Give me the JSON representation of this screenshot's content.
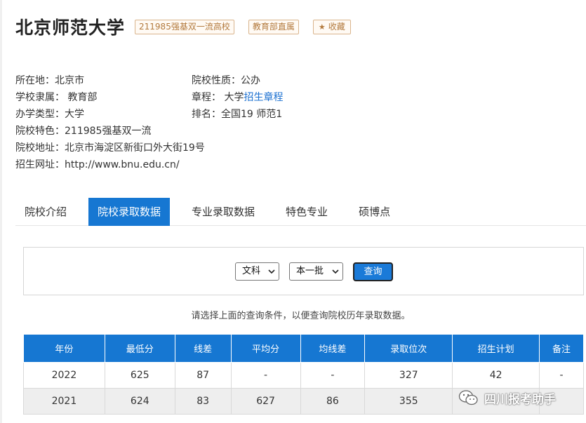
{
  "university": {
    "name": "北京师范大学",
    "tags": [
      "211985强基双一流高校",
      "教育部直属"
    ],
    "favorite_label": "收藏"
  },
  "info_left": [
    {
      "text": "所在地：北京市"
    },
    {
      "text": "学校隶属： 教育部"
    },
    {
      "text": "办学类型：大学"
    },
    {
      "text": "院校特色：211985强基双一流"
    },
    {
      "text": "院校地址：北京市海淀区新街口外大街19号"
    },
    {
      "text": "招生网址：http://www.bnu.edu.cn/"
    }
  ],
  "info_right": {
    "nature": "院校性质：公办",
    "charter_prefix": "章程： 大学",
    "charter_link": "招生章程",
    "ranking": "排名：全国19 师范1"
  },
  "tabs": [
    "院校介绍",
    "院校录取数据",
    "专业录取数据",
    "特色专业",
    "硕博点"
  ],
  "active_tab_index": 1,
  "query": {
    "subject_selected": "文科",
    "batch_selected": "本一批",
    "button_label": "查询"
  },
  "hint": "请选择上面的查询条件，以便查询院校历年录取数据。",
  "table": {
    "headers": [
      "年份",
      "最低分",
      "线差",
      "平均分",
      "均线差",
      "录取位次",
      "招生计划",
      "备注"
    ],
    "rows": [
      [
        "2022",
        "625",
        "87",
        "-",
        "-",
        "327",
        "42",
        "-"
      ],
      [
        "2021",
        "624",
        "83",
        "627",
        "86",
        "355",
        "",
        ""
      ]
    ]
  },
  "watermark": "四川报考助手",
  "colors": {
    "accent_blue": "#1677d2",
    "tag_brown": "#b37a3d",
    "link_blue": "#1a6fd0"
  }
}
